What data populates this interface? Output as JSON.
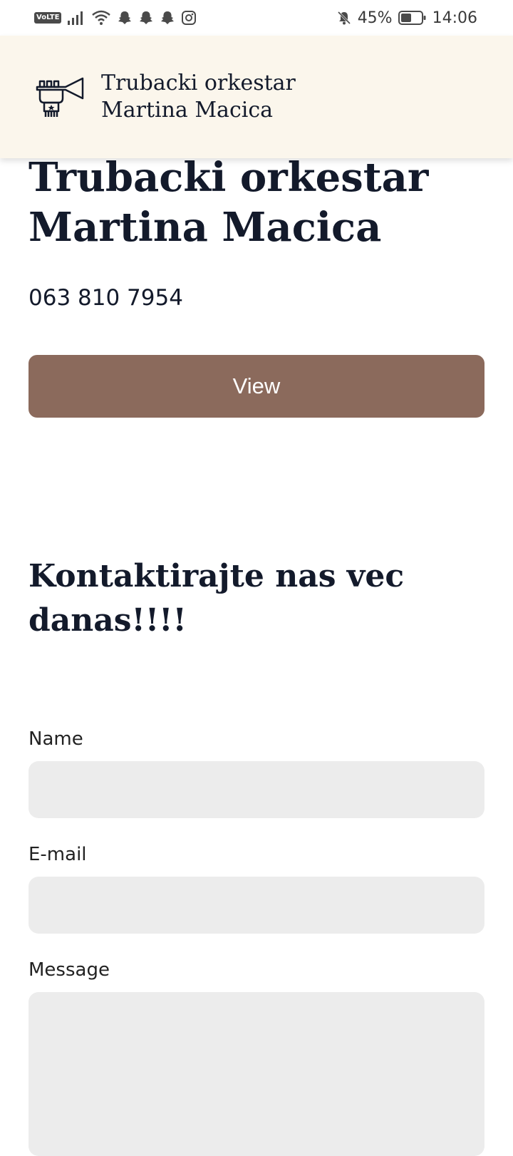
{
  "status_bar": {
    "volte": "VoLTE",
    "battery_percent": "45%",
    "time": "14:06"
  },
  "header": {
    "logo_icon": "trumpet-icon",
    "title": "Trubacki orkestar Martina Macica"
  },
  "hero": {
    "title": "Trubacki orkestar Martina Macica",
    "phone": "063 810 7954",
    "view_button": "View"
  },
  "contact": {
    "title": "Kontaktirajte nas vec danas!!!!",
    "fields": {
      "name_label": "Name",
      "name_value": "",
      "email_label": "E-mail",
      "email_value": "",
      "message_label": "Message",
      "message_value": ""
    }
  },
  "colors": {
    "header_bg": "#fbf6ec",
    "button_bg": "#8b6a5c",
    "field_bg": "#ececec",
    "text": "#131a2b"
  }
}
